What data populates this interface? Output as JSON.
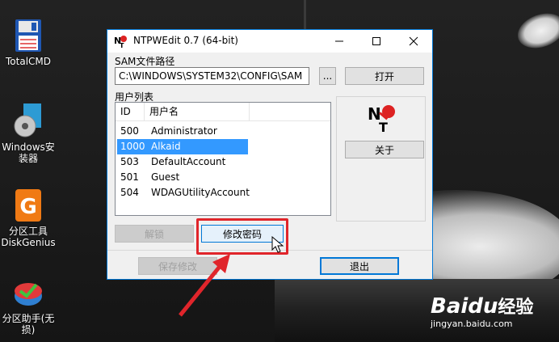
{
  "desktop": {
    "icons": [
      {
        "label": "TotalCMD"
      },
      {
        "label": "Windows安装器"
      },
      {
        "label": "分区工具DiskGenius"
      },
      {
        "label": "分区助手(无损)"
      }
    ],
    "watermark": {
      "brand": "Baidu",
      "suffix": "经验",
      "url": "jingyan.baidu.com"
    }
  },
  "window": {
    "title": "NTPWEdit 0.7 (64-bit)",
    "sam_label": "SAM文件路径",
    "sam_path": "C:\\WINDOWS\\SYSTEM32\\CONFIG\\SAM",
    "browse_label": "...",
    "open_label": "打开",
    "user_list_label": "用户列表",
    "columns": {
      "id": "ID",
      "name": "用户名"
    },
    "users": [
      {
        "id": "500",
        "name": "Administrator"
      },
      {
        "id": "1000",
        "name": "Alkaid"
      },
      {
        "id": "503",
        "name": "DefaultAccount"
      },
      {
        "id": "501",
        "name": "Guest"
      },
      {
        "id": "504",
        "name": "WDAGUtilityAccount"
      }
    ],
    "selected_user_index": 1,
    "about_label": "关于",
    "unlock_label": "解锁",
    "change_password_label": "修改密码",
    "save_label": "保存修改",
    "exit_label": "退出"
  },
  "colors": {
    "accent": "#0078d7",
    "selection": "#3399ff",
    "highlight": "#e0252b"
  }
}
